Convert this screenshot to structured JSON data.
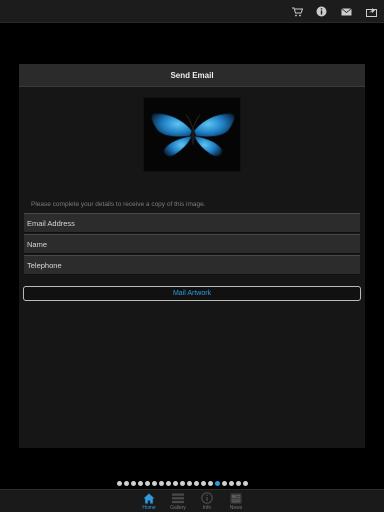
{
  "topbar": {
    "icons": [
      "cart-icon",
      "info-icon",
      "mail-icon",
      "share-icon"
    ]
  },
  "dialog": {
    "title": "Send Email",
    "artwork": "butterfly",
    "instructions": "Please complete your details to receive a copy of this image.",
    "fields": {
      "email_placeholder": "Email Address",
      "name_placeholder": "Name",
      "telephone_placeholder": "Telephone"
    },
    "submit_label": "Mail Artwork"
  },
  "pager": {
    "total": 19,
    "active_index": 14
  },
  "tabs": [
    {
      "label": "Home",
      "icon": "home-icon",
      "active": true
    },
    {
      "label": "Gallery",
      "icon": "gallery-icon",
      "active": false
    },
    {
      "label": "Info",
      "icon": "info-icon",
      "active": false
    },
    {
      "label": "News",
      "icon": "news-icon",
      "active": false
    }
  ],
  "colors": {
    "accent": "#2e9be0",
    "panel": "#161616",
    "field": "#2c2c2c",
    "background": "#000000"
  }
}
